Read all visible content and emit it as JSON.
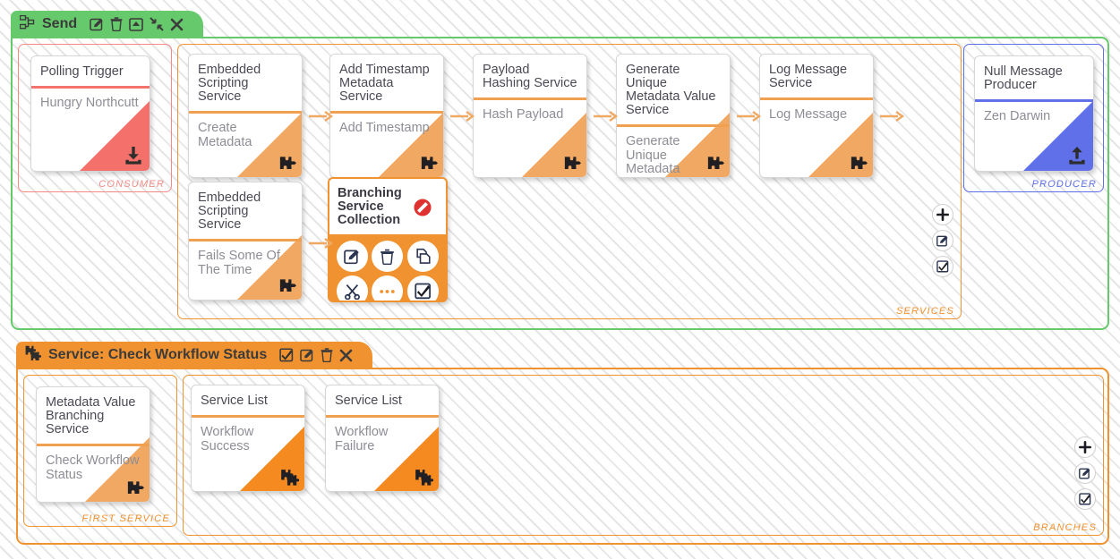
{
  "channel": {
    "header": {
      "icon": "sitemap-icon",
      "title": "Send",
      "actions": [
        {
          "name": "edit-icon",
          "label": "Edit"
        },
        {
          "name": "trash-icon",
          "label": "Delete"
        },
        {
          "name": "collapse-box-icon",
          "label": "Collapse"
        },
        {
          "name": "shrink-icon",
          "label": "Minimise"
        },
        {
          "name": "close-icon",
          "label": "Close"
        }
      ]
    },
    "consumer": {
      "label": "CONSUMER",
      "card": {
        "title": "Polling Trigger",
        "subtitle": "Hungry Northcutt",
        "corner_icon": "download-icon"
      }
    },
    "services": {
      "label": "SERVICES",
      "cards": [
        {
          "title": "Embedded Scripting Service",
          "subtitle": "Create Metadata",
          "corner_icon": "puzzle-icon"
        },
        {
          "title": "Add Timestamp Metadata Service",
          "subtitle": "Add Timestamp",
          "corner_icon": "puzzle-icon"
        },
        {
          "title": "Payload Hashing Service",
          "subtitle": "Hash Payload",
          "corner_icon": "puzzle-icon"
        },
        {
          "title": "Generate Unique Metadata Value Service",
          "subtitle": "Generate Unique Metadata",
          "corner_icon": "puzzle-icon"
        },
        {
          "title": "Log Message Service",
          "subtitle": "Log Message",
          "corner_icon": "puzzle-icon"
        },
        {
          "title": "Embedded Scripting Service",
          "subtitle": "Fails Some Of The Time",
          "corner_icon": "puzzle-icon"
        }
      ],
      "selected_card": {
        "title": "Branching Service Collection",
        "badge_icon": "no-entry-icon",
        "actions": [
          {
            "name": "edit-icon",
            "label": "Edit"
          },
          {
            "name": "trash-icon",
            "label": "Delete"
          },
          {
            "name": "copy-icon",
            "label": "Duplicate"
          },
          {
            "name": "scissors-icon",
            "label": "Cut"
          },
          {
            "name": "ellipsis-icon",
            "label": "More"
          },
          {
            "name": "checkbox-icon",
            "label": "Select"
          }
        ]
      },
      "side_buttons": [
        {
          "name": "plus-icon",
          "label": "Add"
        },
        {
          "name": "edit-icon",
          "label": "Edit"
        },
        {
          "name": "checkbox-icon",
          "label": "Select"
        }
      ]
    },
    "producer": {
      "label": "PRODUCER",
      "card": {
        "title": "Null Message Producer",
        "subtitle": "Zen Darwin",
        "corner_icon": "upload-icon"
      }
    }
  },
  "service_panel": {
    "header": {
      "icon": "branch-puzzle-icon",
      "title": "Service: Check Workflow Status",
      "actions": [
        {
          "name": "checkbox-icon",
          "label": "Select"
        },
        {
          "name": "edit-icon",
          "label": "Edit"
        },
        {
          "name": "trash-icon",
          "label": "Delete"
        },
        {
          "name": "close-icon",
          "label": "Close"
        }
      ]
    },
    "first_service": {
      "label": "FIRST SERVICE",
      "card": {
        "title": "Metadata Value Branching Service",
        "subtitle": "Check Workflow Status",
        "corner_icon": "puzzle-icon"
      }
    },
    "branches": {
      "label": "BRANCHES",
      "cards": [
        {
          "title": "Service List",
          "subtitle": "Workflow Success",
          "corner_icon": "service-list-icon"
        },
        {
          "title": "Service List",
          "subtitle": "Workflow Failure",
          "corner_icon": "service-list-icon"
        }
      ],
      "side_buttons": [
        {
          "name": "plus-icon",
          "label": "Add"
        },
        {
          "name": "edit-icon",
          "label": "Edit"
        },
        {
          "name": "checkbox-icon",
          "label": "Select"
        }
      ]
    }
  },
  "colors": {
    "channel_green": "#66c96b",
    "service_orange": "#f0922f",
    "consumer_red": "#f4736d",
    "producer_blue": "#6070e8",
    "card_corner_orange": "#f0a863"
  }
}
